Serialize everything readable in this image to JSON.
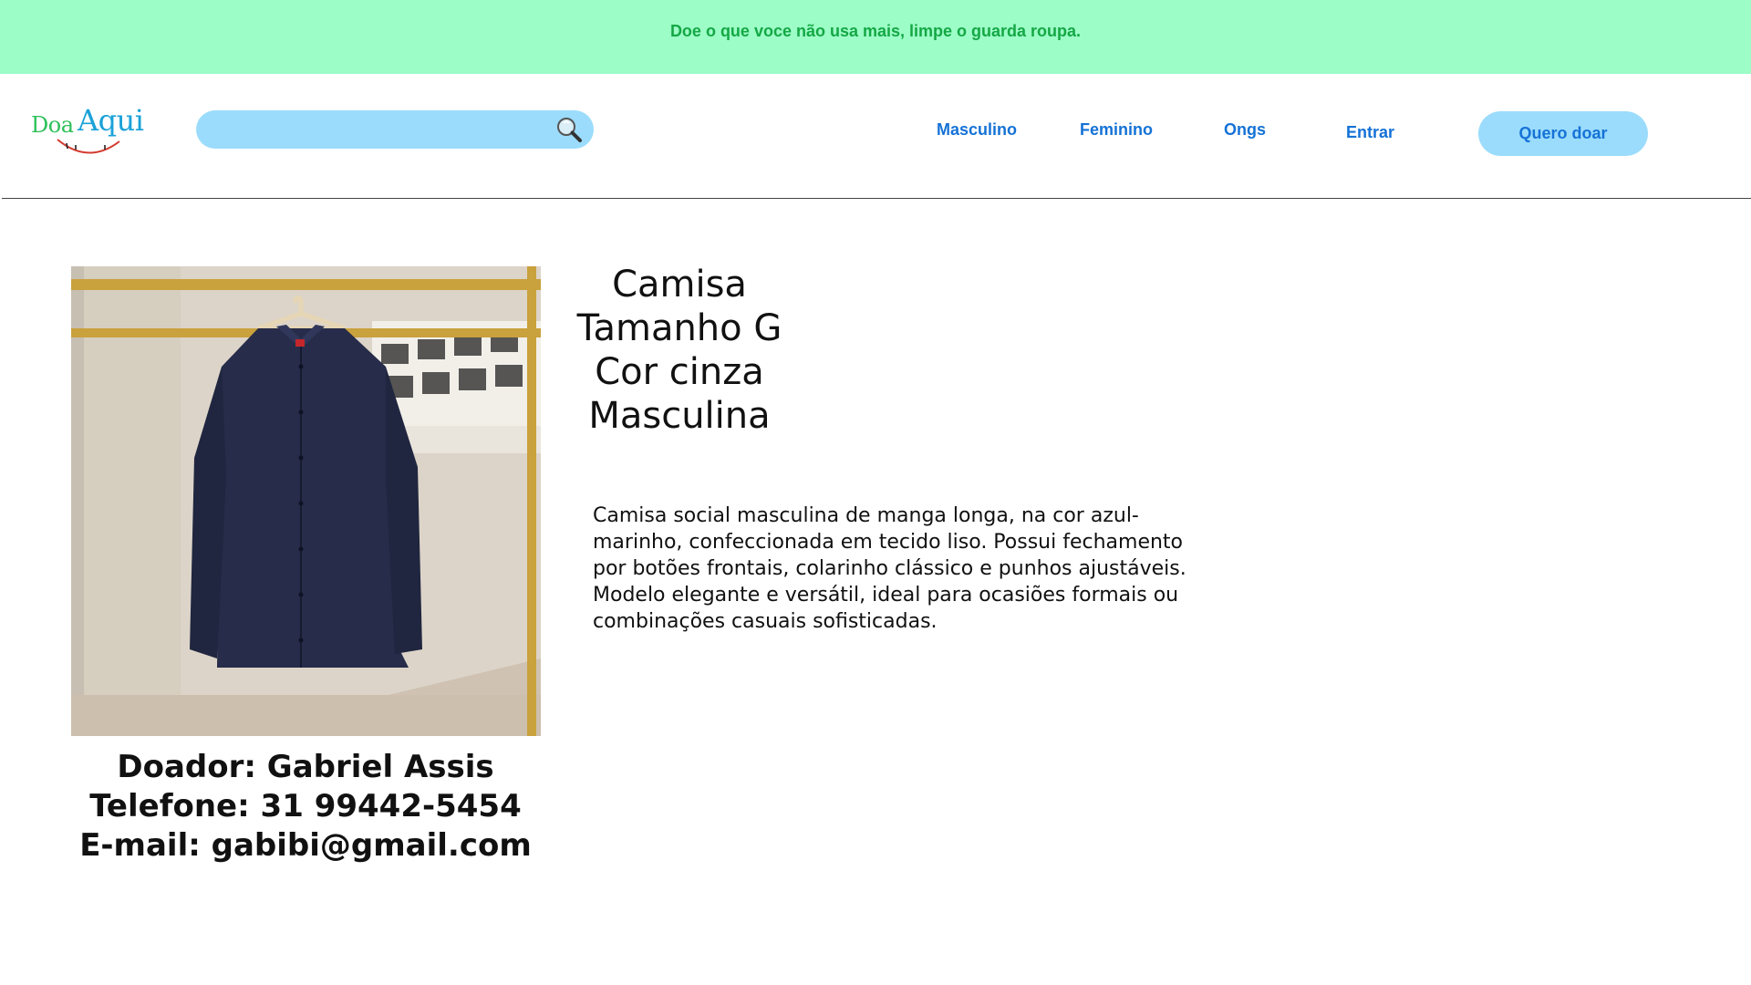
{
  "banner": {
    "text": "Doe o que voce não usa mais, limpe o guarda roupa."
  },
  "header": {
    "logo": {
      "part1": "Doa",
      "part2": "Aqui"
    },
    "search": {
      "value": "",
      "placeholder": ""
    },
    "nav": [
      {
        "label": "Masculino"
      },
      {
        "label": "Feminino"
      },
      {
        "label": "Ongs"
      },
      {
        "label": "Entrar"
      }
    ],
    "cta_label": "Quero doar"
  },
  "product": {
    "title_lines": [
      "Camisa",
      "Tamanho G",
      "Cor cinza",
      "Masculina"
    ],
    "description": "Camisa social masculina de manga longa, na cor azul-marinho, confeccionada em tecido liso. Possui fechamento por botões frontais, colarinho clássico e punhos ajustáveis. Modelo elegante e versátil, ideal para ocasiões formais ou combinações casuais sofisticadas."
  },
  "donor": {
    "name_line": "Doador: Gabriel Assis",
    "phone_line": "Telefone: 31 99442-5454",
    "email_line": "E-mail: gabibi@gmail.com"
  },
  "colors": {
    "banner_bg": "#9dfdc7",
    "banner_text": "#14a845",
    "accent_blue": "#1572d6",
    "pill_bg": "#9bdcfc"
  }
}
